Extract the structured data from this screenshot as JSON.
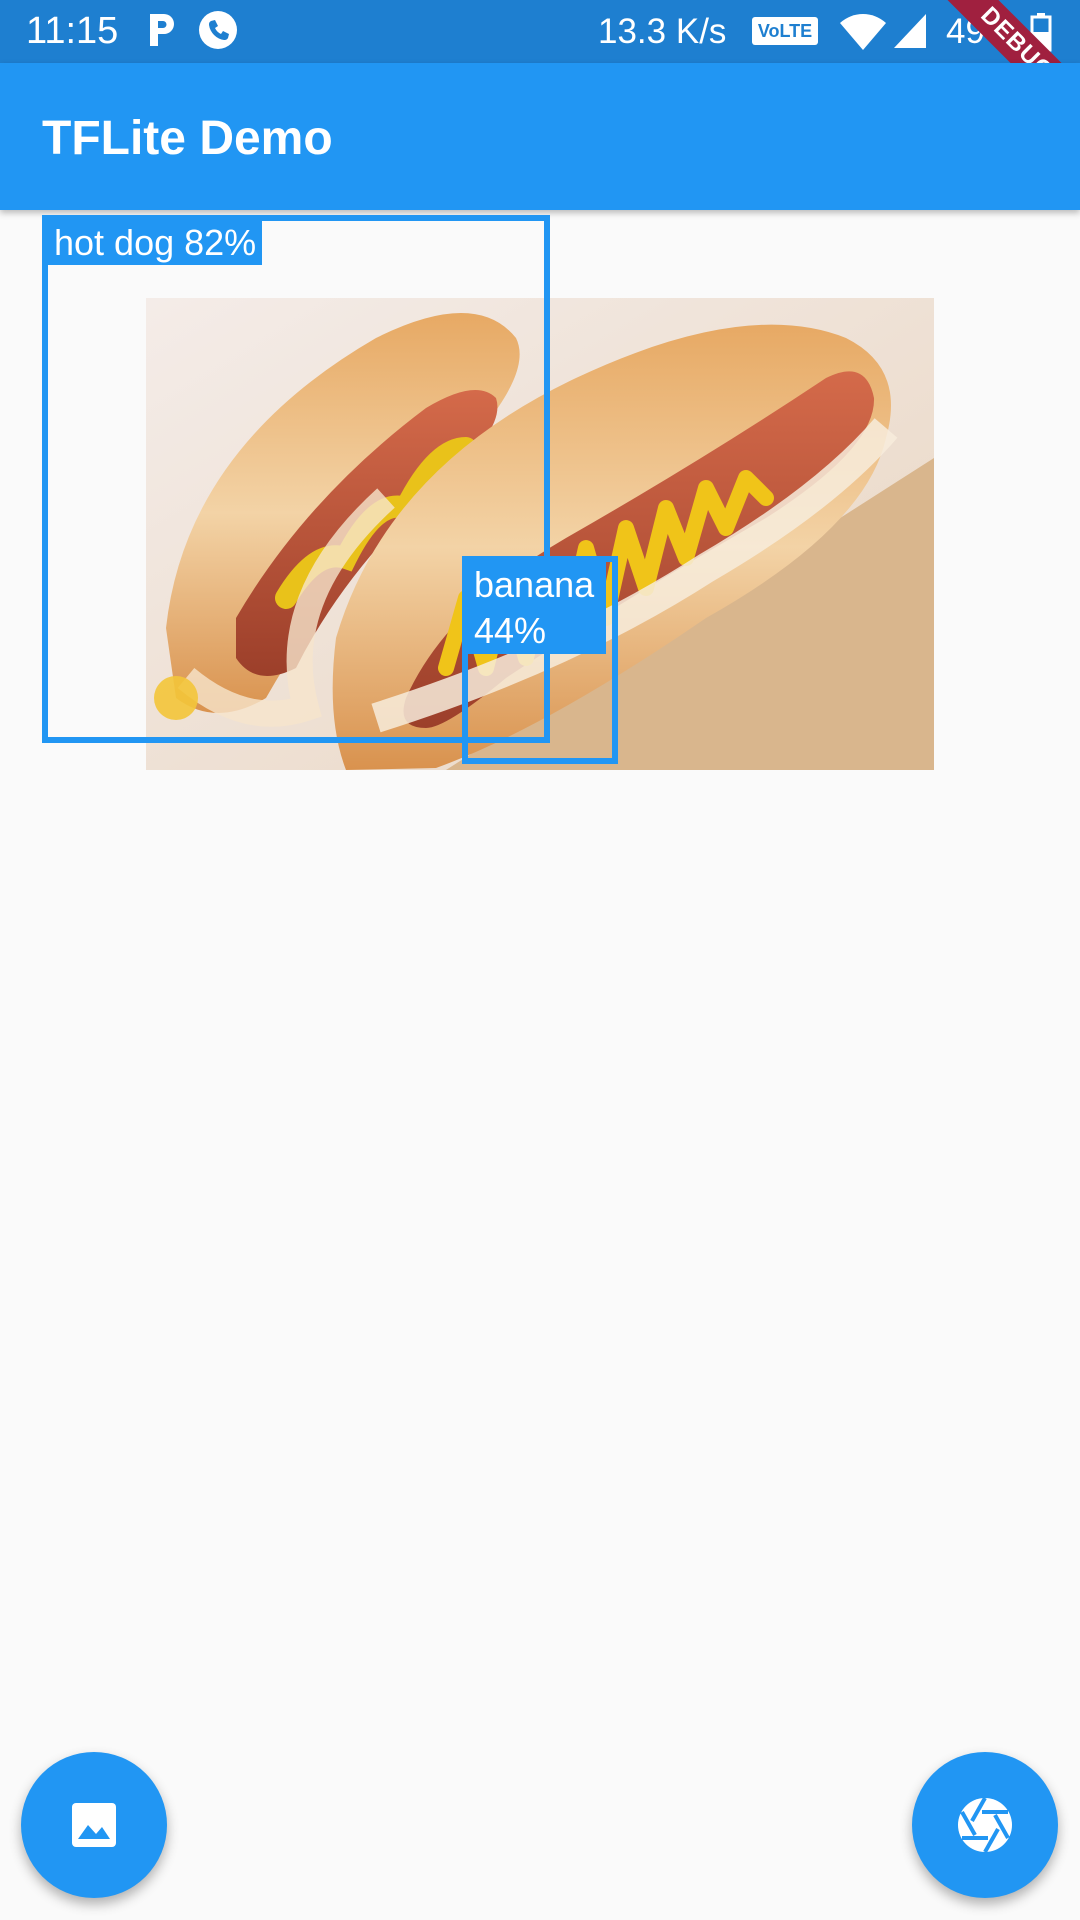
{
  "status_bar": {
    "time": "11:15",
    "network_speed": "13.3 K/s",
    "volte_label": "VoLTE",
    "battery": "49%",
    "debug_label": "DEBUG"
  },
  "app_bar": {
    "title": "TFLite Demo"
  },
  "detections": [
    {
      "label": "hot dog 82%"
    },
    {
      "label": "banana 44%"
    }
  ],
  "fabs": {
    "gallery_icon": "image-icon",
    "camera_icon": "camera-shutter-icon"
  },
  "colors": {
    "primary": "#2196f3",
    "status_bar": "#1e7fd0",
    "background": "#fafafa",
    "debug_ribbon": "#a0203f"
  }
}
